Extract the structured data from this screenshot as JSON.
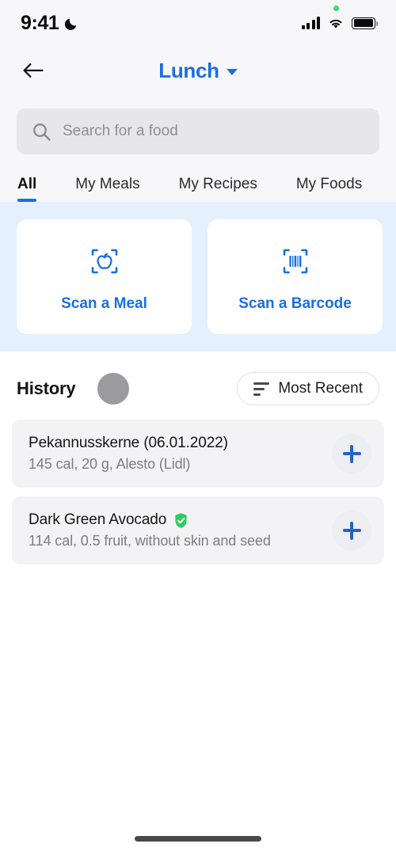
{
  "status_bar": {
    "time": "9:41",
    "dnd_icon": "moon-icon",
    "signal_icon": "cellular-signal-icon",
    "wifi_icon": "wifi-icon",
    "battery_icon": "battery-full-icon",
    "privacy_dot": "green-recording-dot"
  },
  "header": {
    "back_icon": "back-arrow-icon",
    "title": "Lunch",
    "dropdown_icon": "chevron-down-icon"
  },
  "search": {
    "icon": "search-icon",
    "placeholder": "Search for a food",
    "value": ""
  },
  "tabs": [
    {
      "label": "All",
      "active": true
    },
    {
      "label": "My Meals",
      "active": false
    },
    {
      "label": "My Recipes",
      "active": false
    },
    {
      "label": "My Foods",
      "active": false
    }
  ],
  "scan_cards": [
    {
      "label": "Scan a Meal",
      "icon": "apple-scan-icon"
    },
    {
      "label": "Scan a Barcode",
      "icon": "barcode-scan-icon"
    }
  ],
  "history": {
    "heading": "History",
    "loading_indicator": "gray-circle-placeholder",
    "sort": {
      "label": "Most Recent",
      "icon": "sort-lines-icon"
    },
    "items": [
      {
        "title": "Pekannusskerne (06.01.2022)",
        "subtitle": "145 cal, 20 g, Alesto (Lidl)",
        "verified": false,
        "add_icon": "plus-icon"
      },
      {
        "title": "Dark Green Avocado",
        "subtitle": "114 cal, 0.5 fruit, without skin and seed",
        "verified": true,
        "verified_icon": "verified-shield-icon",
        "add_icon": "plus-icon"
      }
    ]
  },
  "home_indicator": "home-indicator-bar",
  "colors": {
    "accent_blue": "#1a6fe0",
    "plus_blue": "#2563c9",
    "scan_band_bg": "#e4f0fb",
    "page_bg": "#ffffff",
    "top_bg": "#f7f7fa",
    "row_bg": "#f3f3f6",
    "verified_green": "#2ecc63",
    "muted_text": "#7c7c84"
  }
}
